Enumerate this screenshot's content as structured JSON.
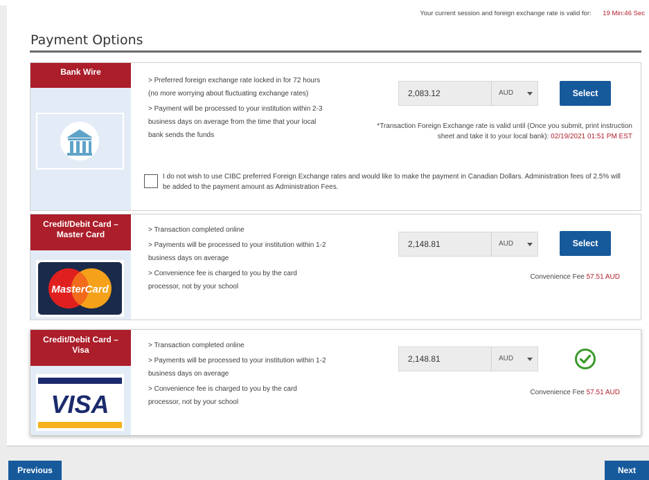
{
  "session": {
    "message": "Your current session and foreign exchange rate is valid for:",
    "timer": "19 Min:46 Sec"
  },
  "page": {
    "title": "Payment Options"
  },
  "options": [
    {
      "name": "Bank Wire",
      "features": [
        "> Preferred foreign exchange rate locked in for 72 hours (no more worrying about fluctuating exchange rates)",
        "> Payment will be processed to your institution within 2-3 business days on average from the time that your local bank sends the funds"
      ],
      "amount": "2,083.12",
      "currency": "AUD",
      "select_label": "Select",
      "rate_note_line1": "*Transaction Foreign Exchange rate is valid until (Once you submit, print instruction",
      "rate_note_line2": "sheet and take it to your local bank):",
      "rate_note_date": "02/19/2021 01:51 PM EST",
      "cad_option": "I do not wish to use CIBC preferred Foreign Exchange rates and would like to make the payment in Canadian Dollars. Administration fees of 2.5% will be added to the payment amount as Administration Fees."
    },
    {
      "name": "Credit/Debit Card – Master Card",
      "features": [
        "> Transaction completed online",
        "> Payments will be processed to your institution within 1-2 business days on average",
        "> Convenience fee is charged to you by the card processor, not by your school"
      ],
      "amount": "2,148.81",
      "currency": "AUD",
      "select_label": "Select",
      "fee_label": "Convenience Fee",
      "fee_amount": "57.51 AUD",
      "logo_text": "MasterCard"
    },
    {
      "name": "Credit/Debit Card – Visa",
      "features": [
        "> Transaction completed online",
        "> Payments will be processed to your institution within 1-2 business days on average",
        "> Convenience fee is charged to you by the card processor, not by your school"
      ],
      "amount": "2,148.81",
      "currency": "AUD",
      "fee_label": "Convenience Fee",
      "fee_amount": "57.51 AUD",
      "logo_text": "VISA",
      "selected": true
    }
  ],
  "nav": {
    "previous": "Previous",
    "next": "Next"
  },
  "colors": {
    "brand_red": "#ab1e2a",
    "button_blue": "#175a9c",
    "check_green": "#3a9a2a"
  },
  "icons": [
    "bank-icon",
    "mastercard-logo",
    "visa-logo",
    "check-circle-icon",
    "chevron-down-icon"
  ]
}
